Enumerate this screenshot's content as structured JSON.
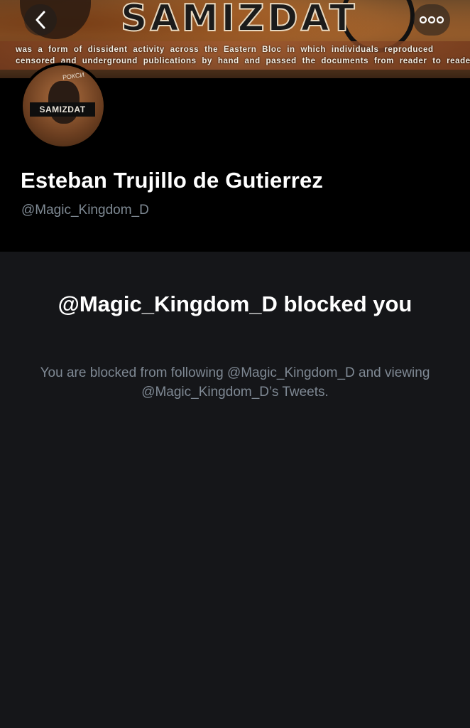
{
  "banner": {
    "title": "SAMIZDAT",
    "line1": "was a form of dissident activity across the Eastern Bloc in which individuals reproduced",
    "line2": "censored and underground publications by hand and passed the documents from reader to reader."
  },
  "nav": {
    "back_icon": "chevron-left-icon",
    "more_icon": "more-dots-icon"
  },
  "profile": {
    "avatar_label": "SAMIZDAT",
    "avatar_tag": "РОКСИ",
    "name": "Esteban Trujillo de Gutierrez",
    "handle": "@Magic_Kingdom_D"
  },
  "blocked": {
    "title": "@Magic_Kingdom_D blocked you",
    "description": "You are blocked from following @Magic_Kingdom_D and viewing @Magic_Kingdom_D’s Tweets."
  },
  "colors": {
    "background": "#151619",
    "header": "#000000",
    "muted_text": "#7f8994",
    "primary_text": "#ffffff"
  }
}
